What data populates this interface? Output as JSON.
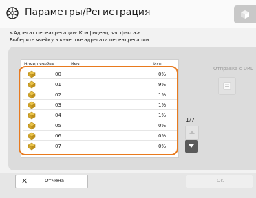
{
  "header": {
    "title": "Параметры/Регистрация",
    "title_icon": "gear-wheel-icon",
    "corner_icon": "cube-icon"
  },
  "instructions": {
    "line1": "<Адресат переадресации: Конфиденц. яч. факса>",
    "line2": "Выберите ячейку в качестве адресата переадресации."
  },
  "table": {
    "columns": [
      "Номер ячейки",
      "Имя",
      "Исп."
    ],
    "row_icon": "mailbox-icon",
    "rows": [
      {
        "num": "00",
        "name": "",
        "use": "0%"
      },
      {
        "num": "01",
        "name": "",
        "use": "9%"
      },
      {
        "num": "02",
        "name": "",
        "use": "1%"
      },
      {
        "num": "03",
        "name": "",
        "use": "1%"
      },
      {
        "num": "04",
        "name": "",
        "use": "1%"
      },
      {
        "num": "05",
        "name": "",
        "use": "0%"
      },
      {
        "num": "06",
        "name": "",
        "use": "0%"
      },
      {
        "num": "07",
        "name": "",
        "use": "0%"
      }
    ],
    "highlight_color": "#e87a1e"
  },
  "pagination": {
    "indicator": "1/7"
  },
  "side": {
    "url_label": "Отправка с URL"
  },
  "footer": {
    "cancel_label": "Отмена",
    "ok_label": "OK"
  }
}
